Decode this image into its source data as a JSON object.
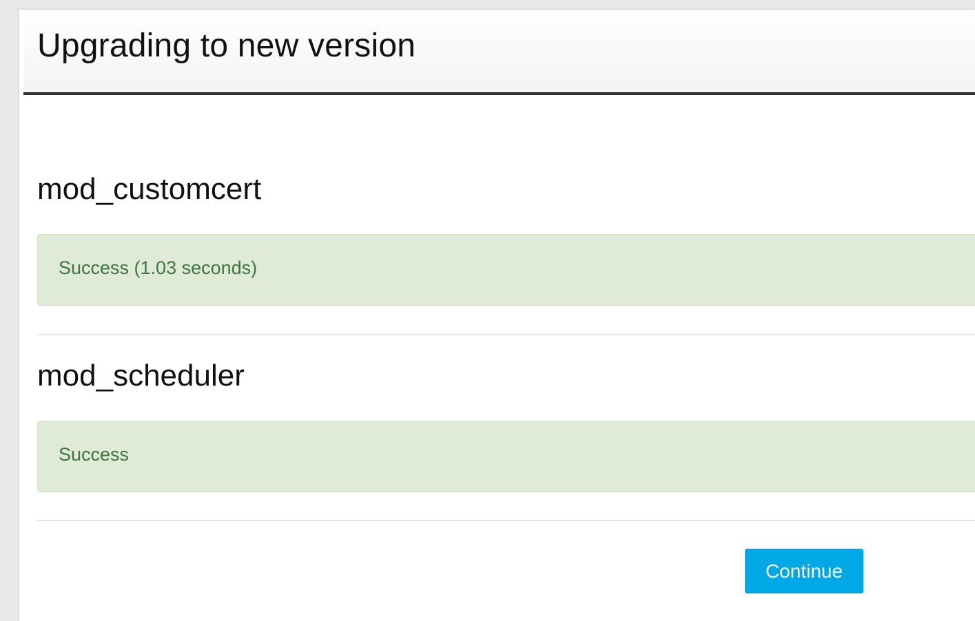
{
  "page": {
    "title": "Upgrading to new version"
  },
  "plugins": [
    {
      "name": "mod_customcert",
      "status": "Success (1.03 seconds)"
    },
    {
      "name": "mod_scheduler",
      "status": "Success"
    }
  ],
  "actions": {
    "continue_label": "Continue"
  },
  "colors": {
    "success_bg": "#dfebd6",
    "success_text": "#3c763d",
    "button_bg": "#00a8e6",
    "header_rule": "#2b3238"
  }
}
